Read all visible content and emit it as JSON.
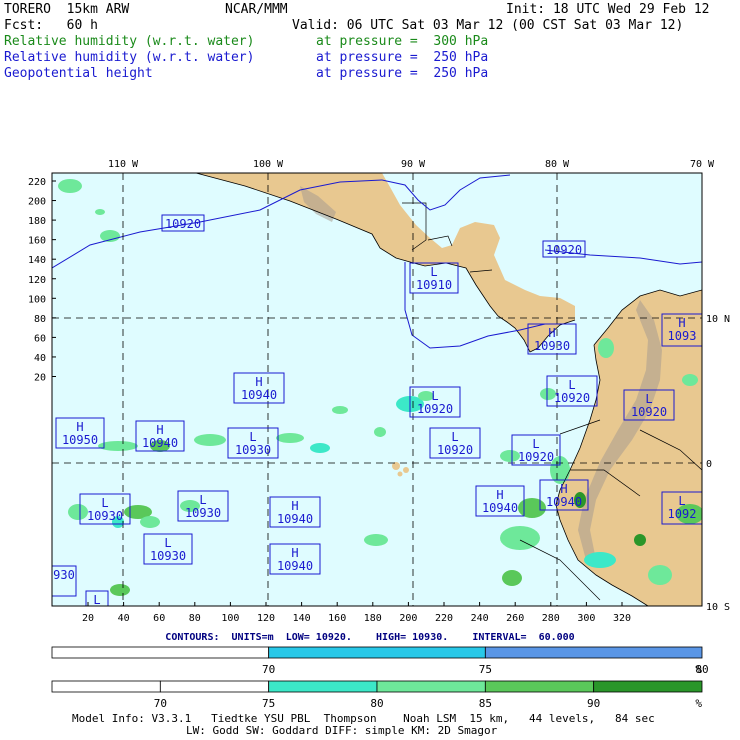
{
  "header": {
    "model": "TORERO  15km ARW",
    "org": "NCAR/MMM",
    "init": "Init: 18 UTC Wed 29 Feb 12",
    "fcst": "Fcst:   60 h",
    "valid": "Valid: 06 UTC Sat 03 Mar 12 (00 CST Sat 03 Mar 12)",
    "fields": [
      {
        "name": "Relative humidity (w.r.t. water)",
        "level": "at pressure =  300 hPa",
        "color": "#1a8a1a"
      },
      {
        "name": "Relative humidity (w.r.t. water)",
        "level": "at pressure =  250 hPa",
        "color": "#1a1ad0"
      },
      {
        "name": "Geopotential height",
        "level": "at pressure =  250 hPa",
        "color": "#1a1ad0"
      }
    ]
  },
  "map": {
    "ocean_color": "#dffcff",
    "land_color": "#e8c890",
    "lon_labels": [
      "110 W",
      "100 W",
      "90 W",
      "80 W",
      "70 W"
    ],
    "lat_labels": [
      "10 N",
      "0",
      "10 S"
    ],
    "y_ticks": [
      "220",
      "200",
      "180",
      "160",
      "140",
      "120",
      "100",
      "80",
      "60",
      "40",
      "20"
    ],
    "x_ticks": [
      "20",
      "40",
      "60",
      "80",
      "100",
      "120",
      "140",
      "160",
      "180",
      "200",
      "220",
      "240",
      "260",
      "280",
      "300",
      "320"
    ],
    "contour_boxes": [
      {
        "type": "",
        "value": "10920"
      },
      {
        "type": "",
        "value": "10920"
      },
      {
        "type": "L",
        "value": "10910"
      },
      {
        "type": "H",
        "value": "10930"
      },
      {
        "type": "H",
        "value": "1093"
      },
      {
        "type": "H",
        "value": "10940"
      },
      {
        "type": "L",
        "value": "10920"
      },
      {
        "type": "L",
        "value": "10920"
      },
      {
        "type": "L",
        "value": "10920"
      },
      {
        "type": "H",
        "value": "10950"
      },
      {
        "type": "H",
        "value": "10940"
      },
      {
        "type": "L",
        "value": "10930"
      },
      {
        "type": "L",
        "value": "10920"
      },
      {
        "type": "L",
        "value": "10920"
      },
      {
        "type": "H",
        "value": "10940"
      },
      {
        "type": "H",
        "value": "10940"
      },
      {
        "type": "L",
        "value": "10930"
      },
      {
        "type": "L",
        "value": "10930"
      },
      {
        "type": "H",
        "value": "10940"
      },
      {
        "type": "L",
        "value": "1092"
      },
      {
        "type": "L",
        "value": "10930"
      },
      {
        "type": "H",
        "value": "10940"
      },
      {
        "type": "",
        "value": "930"
      },
      {
        "type": "L",
        "value": ""
      }
    ]
  },
  "contours_line": "CONTOURS:  UNITS=m  LOW= 10920.    HIGH= 10930.    INTERVAL=  60.000",
  "colorbar1": {
    "labels": [
      "70",
      "75",
      "80",
      "%"
    ],
    "segments": [
      {
        "color": "#ffffff"
      },
      {
        "color": "#28c8e8"
      },
      {
        "color": "#5a96e6"
      }
    ]
  },
  "colorbar2": {
    "labels": [
      "70",
      "75",
      "80",
      "85",
      "90",
      "%"
    ],
    "segments": [
      {
        "color": "#ffffff"
      },
      {
        "color": "#ffffff"
      },
      {
        "color": "#3ce8c8"
      },
      {
        "color": "#6ee89a"
      },
      {
        "color": "#5ac85a"
      },
      {
        "color": "#2a962a"
      }
    ]
  },
  "footer": {
    "line1": "Model Info: V3.3.1   Tiedtke YSU PBL  Thompson    Noah LSM  15 km,   44 levels,   84 sec",
    "line2": "LW: Godd SW: Goddard DIFF: simple KM: 2D Smagor"
  }
}
